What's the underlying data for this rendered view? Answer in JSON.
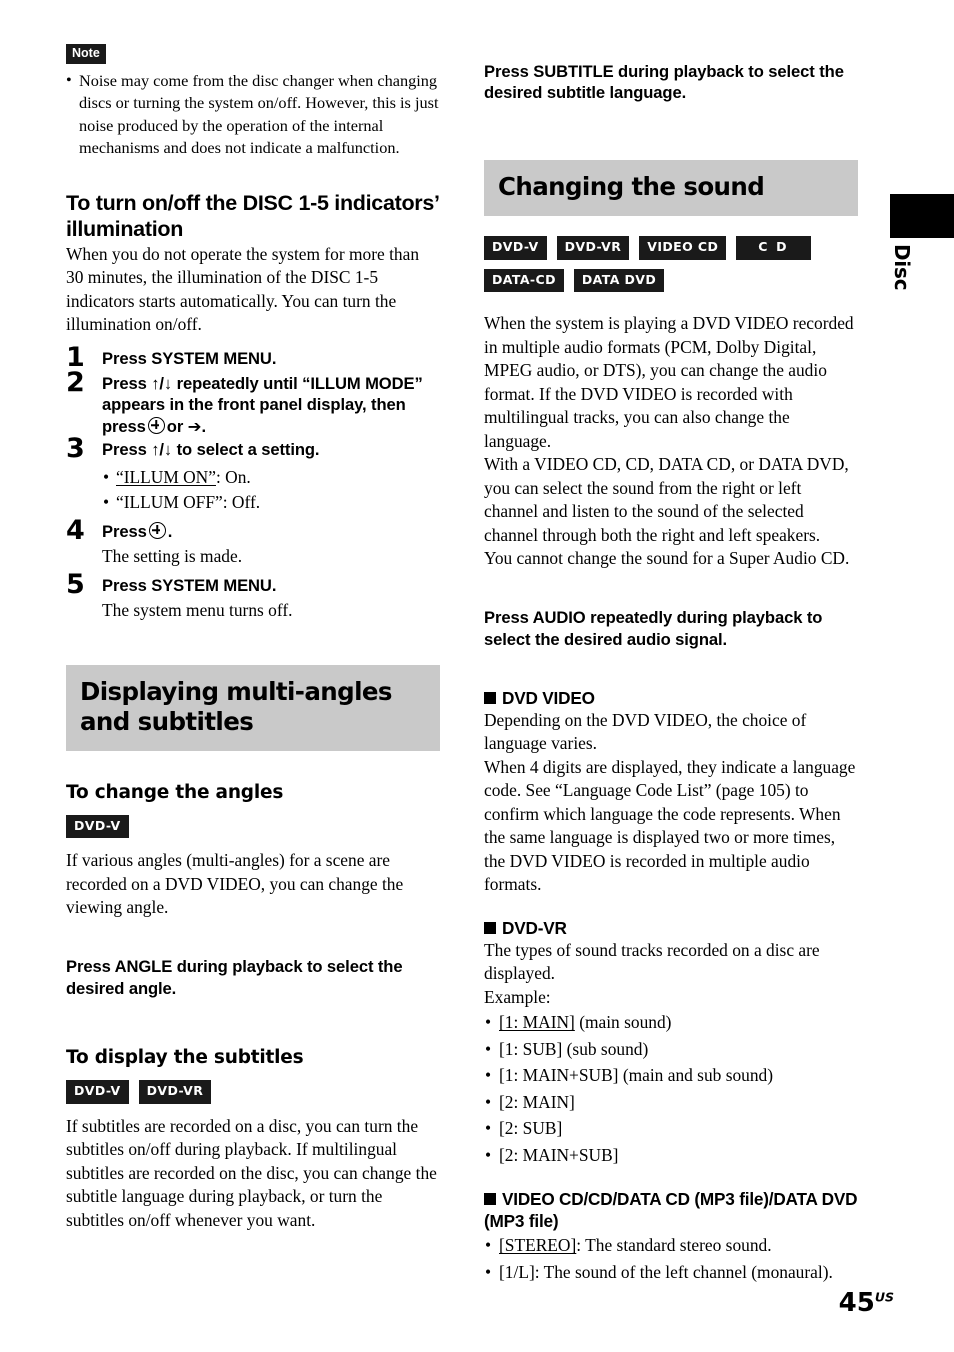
{
  "page": {
    "number": "45",
    "region_suffix": "US",
    "thumb_tab_label": "Disc"
  },
  "colors": {
    "banner_gray": "#c9c9c9",
    "badge_black": "#1a1a1a",
    "text": "#000000"
  },
  "left_column": {
    "note": {
      "tag": "Note",
      "items": [
        "Noise may come from the disc changer when changing discs or turning the system on/off. However, this is just noise produced by the operation of the internal mechanisms and does not indicate a malfunction."
      ]
    },
    "illum_section": {
      "heading": "To turn on/off the DISC 1-5 indicators’ illumination",
      "intro": "When you do not operate the system for more than 30 minutes, the illumination of the DISC 1-5 indicators starts automatically. You can turn the illumination on/off.",
      "steps": [
        {
          "number": "1",
          "instruction": "Press SYSTEM MENU.",
          "instruction_before": "Press SYSTEM MENU.",
          "instruction_after": "",
          "has_enter_icon": false,
          "sub": "",
          "bullets": []
        },
        {
          "number": "2",
          "instruction": "Press ↑/↓ repeatedly until “ILLUM MODE” appears in the front panel display, then press  or ➔.",
          "instruction_before": "Press ↑/↓ repeatedly until “ILLUM MODE” appears in the front panel display, then press",
          "instruction_after": "or ➔.",
          "has_enter_icon": true,
          "sub": "",
          "bullets": []
        },
        {
          "number": "3",
          "instruction": "Press ↑/↓ to select a setting.",
          "instruction_before": "Press ↑/↓ to select a setting.",
          "instruction_after": "",
          "has_enter_icon": false,
          "sub": "",
          "bullets": [
            {
              "underlined": "“ILLUM ON”",
              "rest": ": On."
            },
            {
              "underlined": "",
              "rest": "“ILLUM OFF”: Off."
            }
          ]
        },
        {
          "number": "4",
          "instruction": "Press  .",
          "instruction_before": "Press",
          "instruction_after": ".",
          "has_enter_icon": true,
          "sub": "The setting is made.",
          "bullets": []
        },
        {
          "number": "5",
          "instruction": "Press SYSTEM MENU.",
          "instruction_before": "Press SYSTEM MENU.",
          "instruction_after": "",
          "has_enter_icon": false,
          "sub": "The system menu turns off.",
          "bullets": []
        }
      ]
    },
    "multiangle_section": {
      "banner_title": "Displaying multi-angles and subtitles",
      "angles": {
        "heading": "To change the angles",
        "badges": [
          "DVD-V"
        ],
        "body": "If various angles (multi-angles) for a scene are recorded on a DVD VIDEO, you can change the viewing angle.",
        "instruction": "Press ANGLE during playback to select the desired angle."
      },
      "subtitles": {
        "heading": "To display the subtitles",
        "badges": [
          "DVD-V",
          "DVD-VR"
        ],
        "body": "If subtitles are recorded on a disc, you can turn the subtitles on/off during playback. If multilingual subtitles are recorded on the disc, you can change the subtitle language during playback, or turn the subtitles on/off whenever you want."
      }
    }
  },
  "right_column": {
    "top_instruction": "Press SUBTITLE during playback to select the desired subtitle language.",
    "sound_section": {
      "banner_title": "Changing the sound",
      "badges": [
        "DVD-V",
        "DVD-VR",
        "VIDEO CD",
        "C D",
        "DATA-CD",
        "DATA DVD"
      ],
      "paragraphs": [
        "When the system is playing a DVD VIDEO recorded in multiple audio formats (PCM, Dolby Digital, MPEG audio, or DTS), you can change the audio format. If the DVD VIDEO is recorded with multilingual tracks, you can also change the language.",
        "With a VIDEO CD, CD, DATA CD, or DATA DVD, you can select the sound from the right or left channel and listen to the sound of the selected channel through both the right and left speakers.",
        "You cannot change the sound for a Super Audio CD."
      ],
      "instruction": "Press AUDIO repeatedly during playback to select the desired audio signal.",
      "subsections": [
        {
          "heading": "DVD VIDEO",
          "paragraphs": [
            "Depending on the DVD VIDEO, the choice of language varies.",
            "When 4 digits are displayed, they indicate a language code. See “Language Code List” (page 105) to confirm which language the code represents. When the same language is displayed two or more times, the DVD VIDEO is recorded in multiple audio formats."
          ],
          "bullets": []
        },
        {
          "heading": "DVD-VR",
          "paragraphs": [
            "The types of sound tracks recorded on a disc are displayed.",
            "Example:"
          ],
          "bullets": [
            {
              "underlined": "[1: MAIN]",
              "rest": " (main sound)"
            },
            {
              "underlined": "",
              "rest": "[1: SUB] (sub sound)"
            },
            {
              "underlined": "",
              "rest": "[1: MAIN+SUB] (main and sub sound)"
            },
            {
              "underlined": "",
              "rest": "[2: MAIN]"
            },
            {
              "underlined": "",
              "rest": "[2: SUB]"
            },
            {
              "underlined": "",
              "rest": "[2: MAIN+SUB]"
            }
          ]
        },
        {
          "heading": "VIDEO CD/CD/DATA CD (MP3 file)/DATA DVD (MP3 file)",
          "paragraphs": [],
          "bullets": [
            {
              "underlined": "[STEREO]",
              "rest": ": The standard stereo sound."
            },
            {
              "underlined": "",
              "rest": "[1/L]: The sound of the left channel (monaural)."
            }
          ]
        }
      ]
    }
  }
}
